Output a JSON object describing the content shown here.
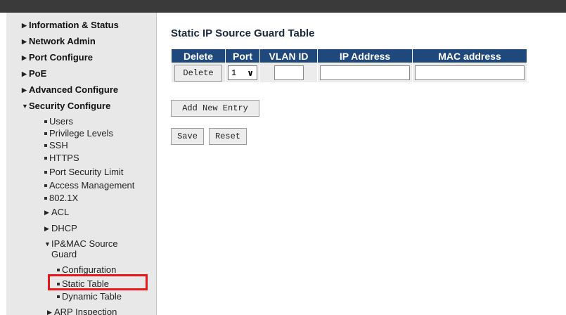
{
  "sidebar": {
    "items": [
      {
        "label": "Information & Status"
      },
      {
        "label": "Network Admin"
      },
      {
        "label": "Port Configure"
      },
      {
        "label": "PoE"
      },
      {
        "label": "Advanced Configure"
      },
      {
        "label": "Security Configure"
      }
    ],
    "security": {
      "users": "Users",
      "privilege_levels": "Privilege Levels",
      "ssh": "SSH",
      "https": "HTTPS",
      "port_security_limit": "Port Security Limit",
      "access_management": "Access Management",
      "dot1x": "802.1X",
      "acl": "ACL",
      "dhcp": "DHCP",
      "ipmac_line1": "IP&MAC Source",
      "ipmac_line2": "Guard",
      "configuration": "Configuration",
      "static_table": "Static Table",
      "dynamic_table": "Dynamic Table",
      "arp_inspection": "ARP Inspection"
    }
  },
  "main": {
    "title": "Static IP Source Guard Table",
    "columns": [
      "Delete",
      "Port",
      "VLAN ID",
      "IP Address",
      "MAC address"
    ],
    "row": {
      "delete_label": "Delete",
      "port_value": "1",
      "vlan_value": "",
      "ip_value": "",
      "mac_value": ""
    },
    "add_new_entry_label": "Add New Entry",
    "save_label": "Save",
    "reset_label": "Reset"
  },
  "colors": {
    "header_bg": "#1f497d",
    "highlight_border": "#e8171c",
    "sidebar_bg": "#e8e8e8"
  }
}
